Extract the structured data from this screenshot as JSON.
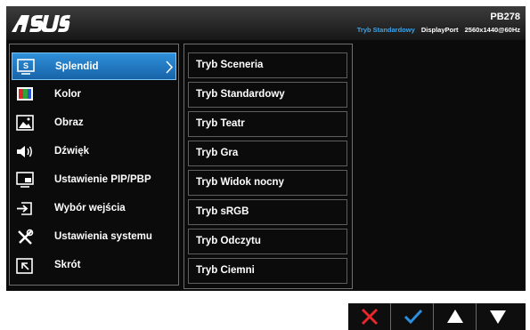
{
  "header": {
    "brand": "ASUS",
    "model": "PB278",
    "status": {
      "mode": "Tryb Standardowy",
      "input": "DisplayPort",
      "resolution": "2560x1440@60Hz"
    }
  },
  "menu": {
    "items": [
      {
        "label": "Splendid",
        "icon": "splendid-icon",
        "active": true
      },
      {
        "label": "Kolor",
        "icon": "color-icon"
      },
      {
        "label": "Obraz",
        "icon": "image-icon"
      },
      {
        "label": "Dźwięk",
        "icon": "speaker-icon"
      },
      {
        "label": "Ustawienie PIP/PBP",
        "icon": "pip-icon"
      },
      {
        "label": "Wybór wejścia",
        "icon": "input-icon"
      },
      {
        "label": "Ustawienia systemu",
        "icon": "tools-icon"
      },
      {
        "label": "Skrót",
        "icon": "shortcut-icon"
      }
    ]
  },
  "submenu": {
    "items": [
      "Tryb Sceneria",
      "Tryb Standardowy",
      "Tryb Teatr",
      "Tryb Gra",
      "Tryb Widok nocny",
      "Tryb sRGB",
      "Tryb Odczytu",
      "Tryb Ciemni"
    ]
  },
  "keys": [
    "close-icon",
    "check-icon",
    "up-icon",
    "down-icon"
  ],
  "colors": {
    "accent": "#1f7fd0",
    "status_mode": "#3da3e6",
    "close": "#e8262b",
    "check": "#2c8fe0"
  }
}
